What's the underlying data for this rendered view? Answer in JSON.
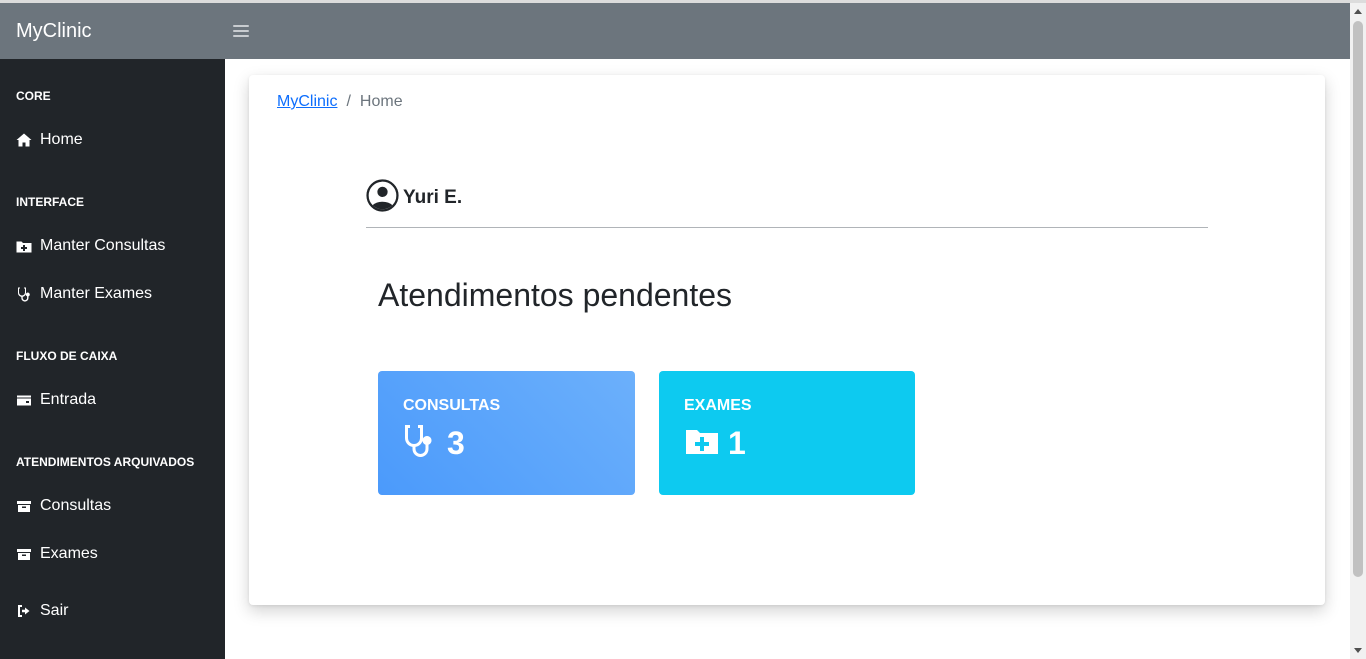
{
  "navbar": {
    "brand": "MyClinic",
    "toggle_icon": "menu-icon"
  },
  "sidebar": {
    "sections": [
      {
        "heading": "CORE",
        "items": [
          {
            "label": "Home",
            "icon": "home-icon"
          }
        ]
      },
      {
        "heading": "INTERFACE",
        "items": [
          {
            "label": "Manter Consultas",
            "icon": "folder-plus-icon"
          },
          {
            "label": "Manter Exames",
            "icon": "stethoscope-icon"
          }
        ]
      },
      {
        "heading": "FLUXO DE CAIXA",
        "items": [
          {
            "label": "Entrada",
            "icon": "wallet-icon"
          }
        ]
      },
      {
        "heading": "ATENDIMENTOS ARQUIVADOS",
        "items": [
          {
            "label": "Consultas",
            "icon": "archive-icon"
          },
          {
            "label": "Exames",
            "icon": "archive-icon"
          }
        ]
      }
    ],
    "logout": {
      "label": "Sair",
      "icon": "sign-out-icon"
    }
  },
  "breadcrumb": {
    "root": "MyClinic",
    "separator": "/",
    "current": "Home"
  },
  "user": {
    "name": "Yuri E.",
    "icon": "user-circle-icon"
  },
  "main": {
    "title": "Atendimentos pendentes",
    "stats": [
      {
        "label": "CONSULTAS",
        "value": "3",
        "icon": "stethoscope-icon",
        "color": "#4b9afb"
      },
      {
        "label": "EXAMES",
        "value": "1",
        "icon": "folder-plus-icon",
        "color": "#0dcaf0"
      }
    ]
  },
  "colors": {
    "navbar": "#6c757d",
    "sidebar": "#212529",
    "link": "#0d6efd"
  }
}
